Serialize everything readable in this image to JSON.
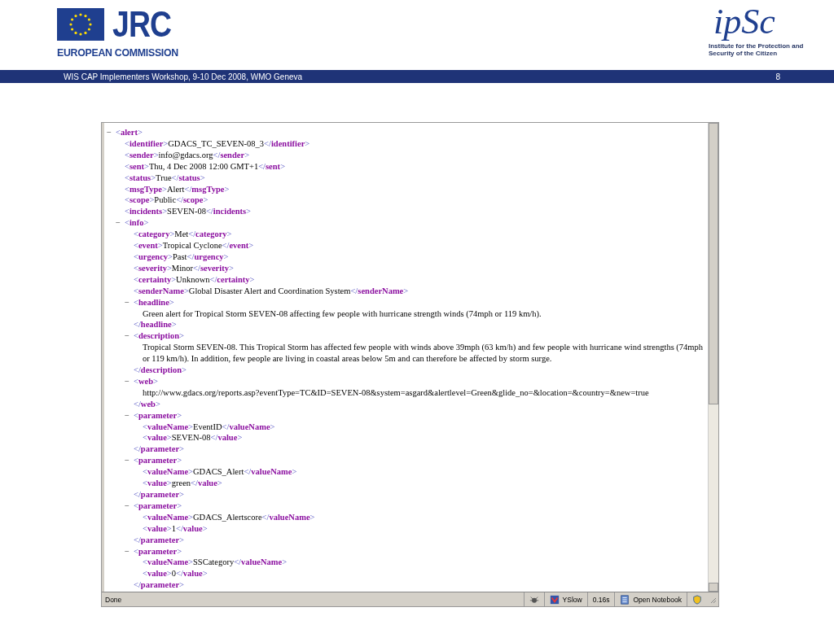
{
  "slide_header": {
    "left_logo": {
      "wordmark": "JRC",
      "caption": "EUROPEAN COMMISSION"
    },
    "right_logo": {
      "wordmark": "ipSc",
      "caption": "Institute for the Protection and Security of the Citizen"
    }
  },
  "footer_bar": {
    "title": "WIS CAP Implementers Workshop, 9-10 Dec 2008, WMO Geneva",
    "page_number": "8"
  },
  "browser": {
    "xml_tree": [
      {
        "toggle": "−",
        "open": "<alert>",
        "expanded": true,
        "children": [
          {
            "open": "<identifier>",
            "text": "GDACS_TC_SEVEN-08_3",
            "close": "</identifier>"
          },
          {
            "open": "<sender>",
            "text": "info@gdacs.org",
            "close": "</sender>"
          },
          {
            "open": "<sent>",
            "text": "Thu, 4 Dec 2008 12:00 GMT+1",
            "close": "</sent>"
          },
          {
            "open": "<status>",
            "text": "True",
            "close": "</status>"
          },
          {
            "open": "<msgType>",
            "text": "Alert",
            "close": "</msgType>"
          },
          {
            "open": "<scope>",
            "text": "Public",
            "close": "</scope>"
          },
          {
            "open": "<incidents>",
            "text": "SEVEN-08",
            "close": "</incidents>"
          },
          {
            "toggle": "−",
            "open": "<info>",
            "expanded": true,
            "children": [
              {
                "open": "<category>",
                "text": "Met",
                "close": "</category>"
              },
              {
                "open": "<event>",
                "text": "Tropical Cyclone",
                "close": "</event>"
              },
              {
                "open": "<urgency>",
                "text": "Past",
                "close": "</urgency>"
              },
              {
                "open": "<severity>",
                "text": "Minor",
                "close": "</severity>"
              },
              {
                "open": "<certainty>",
                "text": "Unknown",
                "close": "</certainty>"
              },
              {
                "open": "<senderName>",
                "text": "Global Disaster Alert and Coordination System",
                "close": "</senderName>"
              },
              {
                "toggle": "−",
                "open": "<headline>",
                "expanded": true,
                "block_text": "Green alert for Tropical Storm SEVEN-08 affecting few people with hurricane strength winds (74mph or 119 km/h).",
                "close": "</headline>"
              },
              {
                "toggle": "−",
                "open": "<description>",
                "expanded": true,
                "block_text": "Tropical Storm SEVEN-08. This Tropical Storm has affected few people with winds above 39mph (63 km/h) and few people with hurricane wind strengths (74mph or 119 km/h). In addition, few people are living in coastal areas below 5m and can therefore be affected by storm surge.",
                "close": "</description>"
              },
              {
                "toggle": "−",
                "open": "<web>",
                "expanded": true,
                "block_text": "http://www.gdacs.org/reports.asp?eventType=TC&ID=SEVEN-08&system=asgard&alertlevel=Green&glide_no=&location=&country=&new=true",
                "close": "</web>"
              },
              {
                "toggle": "−",
                "open": "<parameter>",
                "expanded": true,
                "children": [
                  {
                    "open": "<valueName>",
                    "text": "EventID",
                    "close": "</valueName>"
                  },
                  {
                    "open": "<value>",
                    "text": "SEVEN-08",
                    "close": "</value>"
                  }
                ],
                "close": "</parameter>"
              },
              {
                "toggle": "−",
                "open": "<parameter>",
                "expanded": true,
                "children": [
                  {
                    "open": "<valueName>",
                    "text": "GDACS_Alert",
                    "close": "</valueName>"
                  },
                  {
                    "open": "<value>",
                    "text": "green",
                    "close": "</value>"
                  }
                ],
                "close": "</parameter>"
              },
              {
                "toggle": "−",
                "open": "<parameter>",
                "expanded": true,
                "children": [
                  {
                    "open": "<valueName>",
                    "text": "GDACS_Alertscore",
                    "close": "</valueName>"
                  },
                  {
                    "open": "<value>",
                    "text": "1",
                    "close": "</value>"
                  }
                ],
                "close": "</parameter>"
              },
              {
                "toggle": "−",
                "open": "<parameter>",
                "expanded": true,
                "children": [
                  {
                    "open": "<valueName>",
                    "text": "SSCategory",
                    "close": "</valueName>"
                  },
                  {
                    "open": "<value>",
                    "text": "0",
                    "close": "</value>"
                  }
                ],
                "close": "</parameter>"
              }
            ]
          }
        ]
      }
    ],
    "status_bar": {
      "status": "Done",
      "yslow_label": "YSlow",
      "load_time": "0.16s",
      "notebook_label": "Open Notebook"
    }
  }
}
